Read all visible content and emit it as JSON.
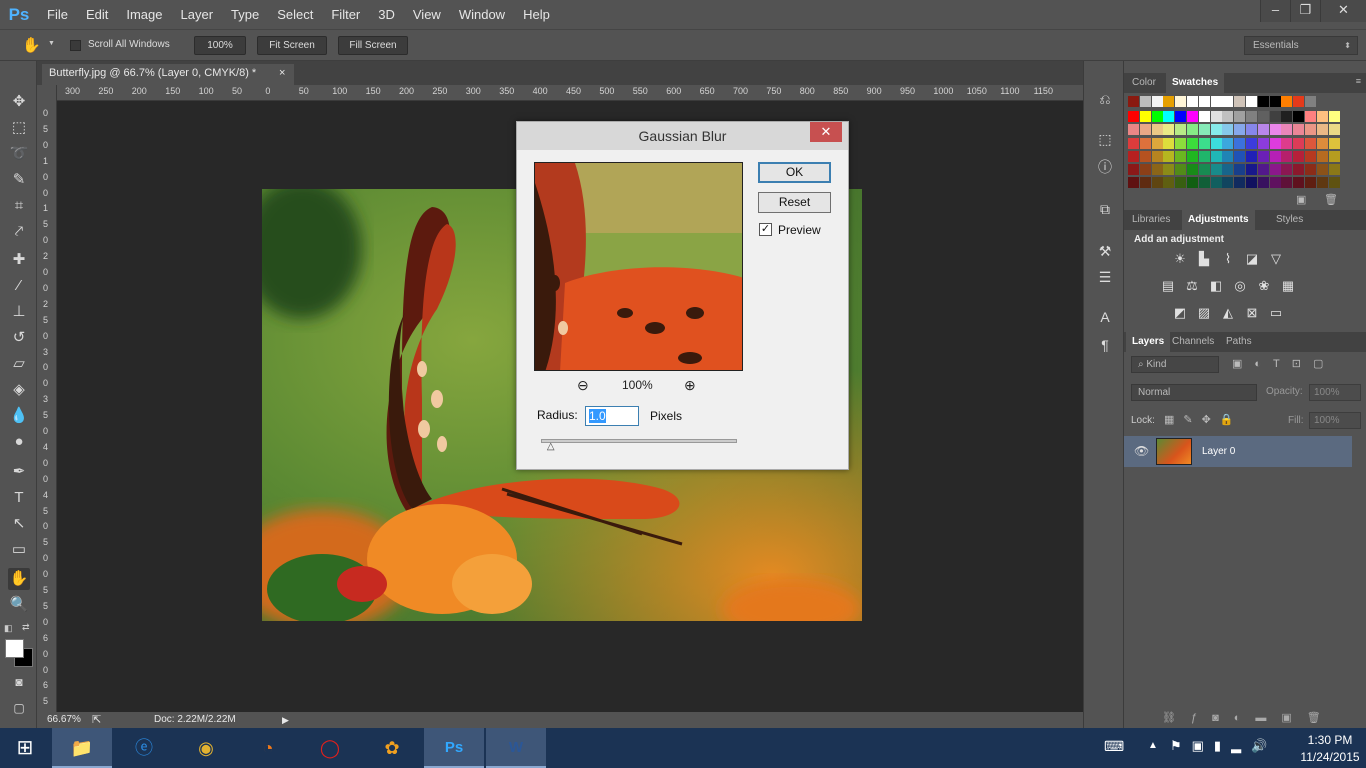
{
  "app": {
    "logo": "Ps",
    "accent": "#31a8ff"
  },
  "menu": [
    "File",
    "Edit",
    "Image",
    "Layer",
    "Type",
    "Select",
    "Filter",
    "3D",
    "View",
    "Window",
    "Help"
  ],
  "window_controls": [
    "‒",
    "❐",
    "✕"
  ],
  "options": {
    "scroll_all_windows": "Scroll All Windows",
    "btn_100": "100%",
    "fit_screen": "Fit Screen",
    "fill_screen": "Fill Screen",
    "workspace": "Essentials"
  },
  "document": {
    "tab_title": "Butterfly.jpg @ 66.7% (Layer 0, CMYK/8) *",
    "tab_close": "×"
  },
  "ruler_h": [
    "300",
    "250",
    "200",
    "150",
    "100",
    "50",
    "0",
    "50",
    "100",
    "150",
    "200",
    "250",
    "300",
    "350",
    "400",
    "450",
    "500",
    "550",
    "600",
    "650",
    "700",
    "750",
    "800",
    "850",
    "900",
    "950",
    "1000",
    "1050",
    "1100",
    "1150"
  ],
  "ruler_v": [
    "0",
    "5",
    "0",
    "1",
    "0",
    "0",
    "1",
    "5",
    "0",
    "2",
    "0",
    "0",
    "2",
    "5",
    "0",
    "3",
    "0",
    "0",
    "3",
    "5",
    "0",
    "4",
    "0",
    "0",
    "4",
    "5",
    "0",
    "5",
    "0",
    "0",
    "5",
    "5",
    "0",
    "6",
    "0",
    "0",
    "6",
    "5",
    "0"
  ],
  "status": {
    "zoom": "66.67%",
    "doc": "Doc: 2.22M/2.22M"
  },
  "dialog": {
    "title": "Gaussian Blur",
    "ok": "OK",
    "reset": "Reset",
    "preview_label": "Preview",
    "preview_checked": true,
    "zoom": "100%",
    "radius_label": "Radius:",
    "radius_value": "1.0",
    "units": "Pixels",
    "slider_level": 0.04
  },
  "panels": {
    "color_tab": "Color",
    "swatches_tab": "Swatches",
    "libraries_tab": "Libraries",
    "adjustments_tab": "Adjustments",
    "styles_tab": "Styles",
    "add_adjustment": "Add an adjustment",
    "layers_tab": "Layers",
    "channels_tab": "Channels",
    "paths_tab": "Paths",
    "kind": "Kind",
    "blend_mode": "Normal",
    "opacity_label": "Opacity:",
    "opacity_value": "100%",
    "lock_label": "Lock:",
    "fill_label": "Fill:",
    "fill_value": "100%",
    "layer_name": "Layer 0"
  },
  "taskbar": {
    "time": "1:30 PM",
    "date": "11/24/2015"
  }
}
